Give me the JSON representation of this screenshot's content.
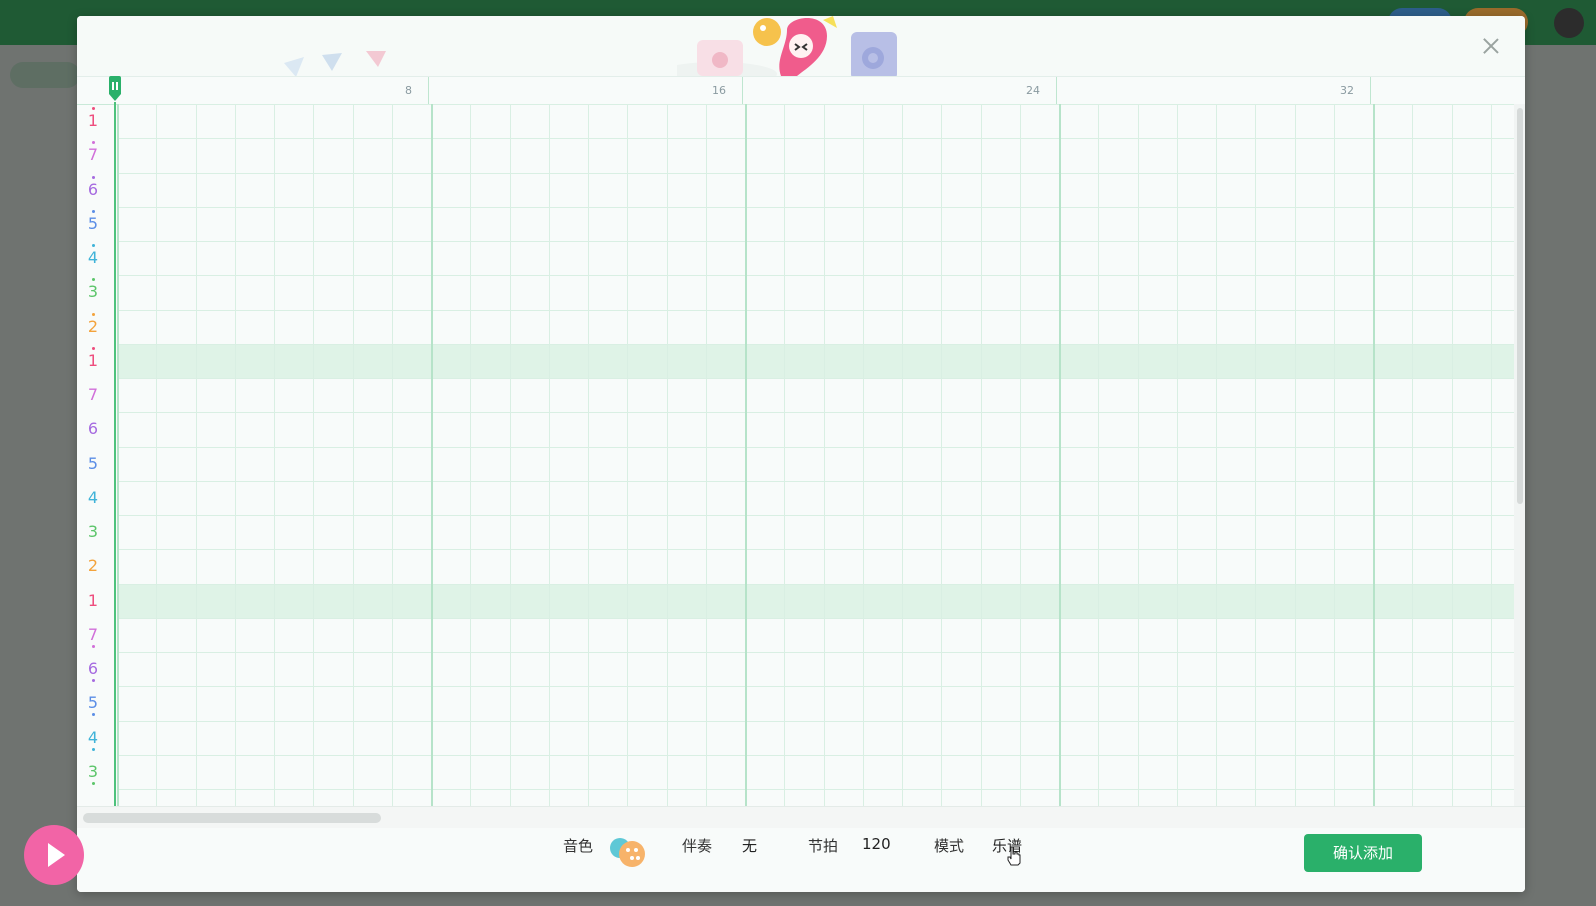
{
  "ruler": {
    "marks": [
      "8",
      "16",
      "24",
      "32"
    ]
  },
  "note_rows": [
    {
      "label": "1",
      "dot": "top",
      "color": "#ee4d7d"
    },
    {
      "label": "7",
      "dot": "top",
      "color": "#d16fd9"
    },
    {
      "label": "6",
      "dot": "top",
      "color": "#a66be0"
    },
    {
      "label": "5",
      "dot": "top",
      "color": "#5b8ee6"
    },
    {
      "label": "4",
      "dot": "top",
      "color": "#3fb3d8"
    },
    {
      "label": "3",
      "dot": "top",
      "color": "#5cc56a"
    },
    {
      "label": "2",
      "dot": "top",
      "color": "#f3a33c"
    },
    {
      "label": "1",
      "dot": "top",
      "color": "#ee4d7d"
    },
    {
      "label": "7",
      "dot": "none",
      "color": "#d16fd9"
    },
    {
      "label": "6",
      "dot": "none",
      "color": "#a66be0"
    },
    {
      "label": "5",
      "dot": "none",
      "color": "#5b8ee6"
    },
    {
      "label": "4",
      "dot": "none",
      "color": "#3fb3d8"
    },
    {
      "label": "3",
      "dot": "none",
      "color": "#5cc56a"
    },
    {
      "label": "2",
      "dot": "none",
      "color": "#f3a33c"
    },
    {
      "label": "1",
      "dot": "none",
      "color": "#ee4d7d"
    },
    {
      "label": "7",
      "dot": "bottom",
      "color": "#d16fd9"
    },
    {
      "label": "6",
      "dot": "bottom",
      "color": "#a66be0"
    },
    {
      "label": "5",
      "dot": "bottom",
      "color": "#5b8ee6"
    },
    {
      "label": "4",
      "dot": "bottom",
      "color": "#3fb3d8"
    },
    {
      "label": "3",
      "dot": "bottom",
      "color": "#5cc56a"
    }
  ],
  "highlighted_rows": [
    7,
    14
  ],
  "controls": {
    "timbre_label": "音色",
    "timbre_icon": "balloons-icon",
    "accompaniment_label": "伴奏",
    "accompaniment_value": "无",
    "tempo_label": "节拍",
    "tempo_value": "120",
    "mode_label": "模式",
    "mode_value": "乐谱"
  },
  "confirm_label": "确认添加",
  "colors": {
    "accent": "#2ab06a",
    "play": "#f264a6",
    "highlight_row": "#dff3e7"
  }
}
